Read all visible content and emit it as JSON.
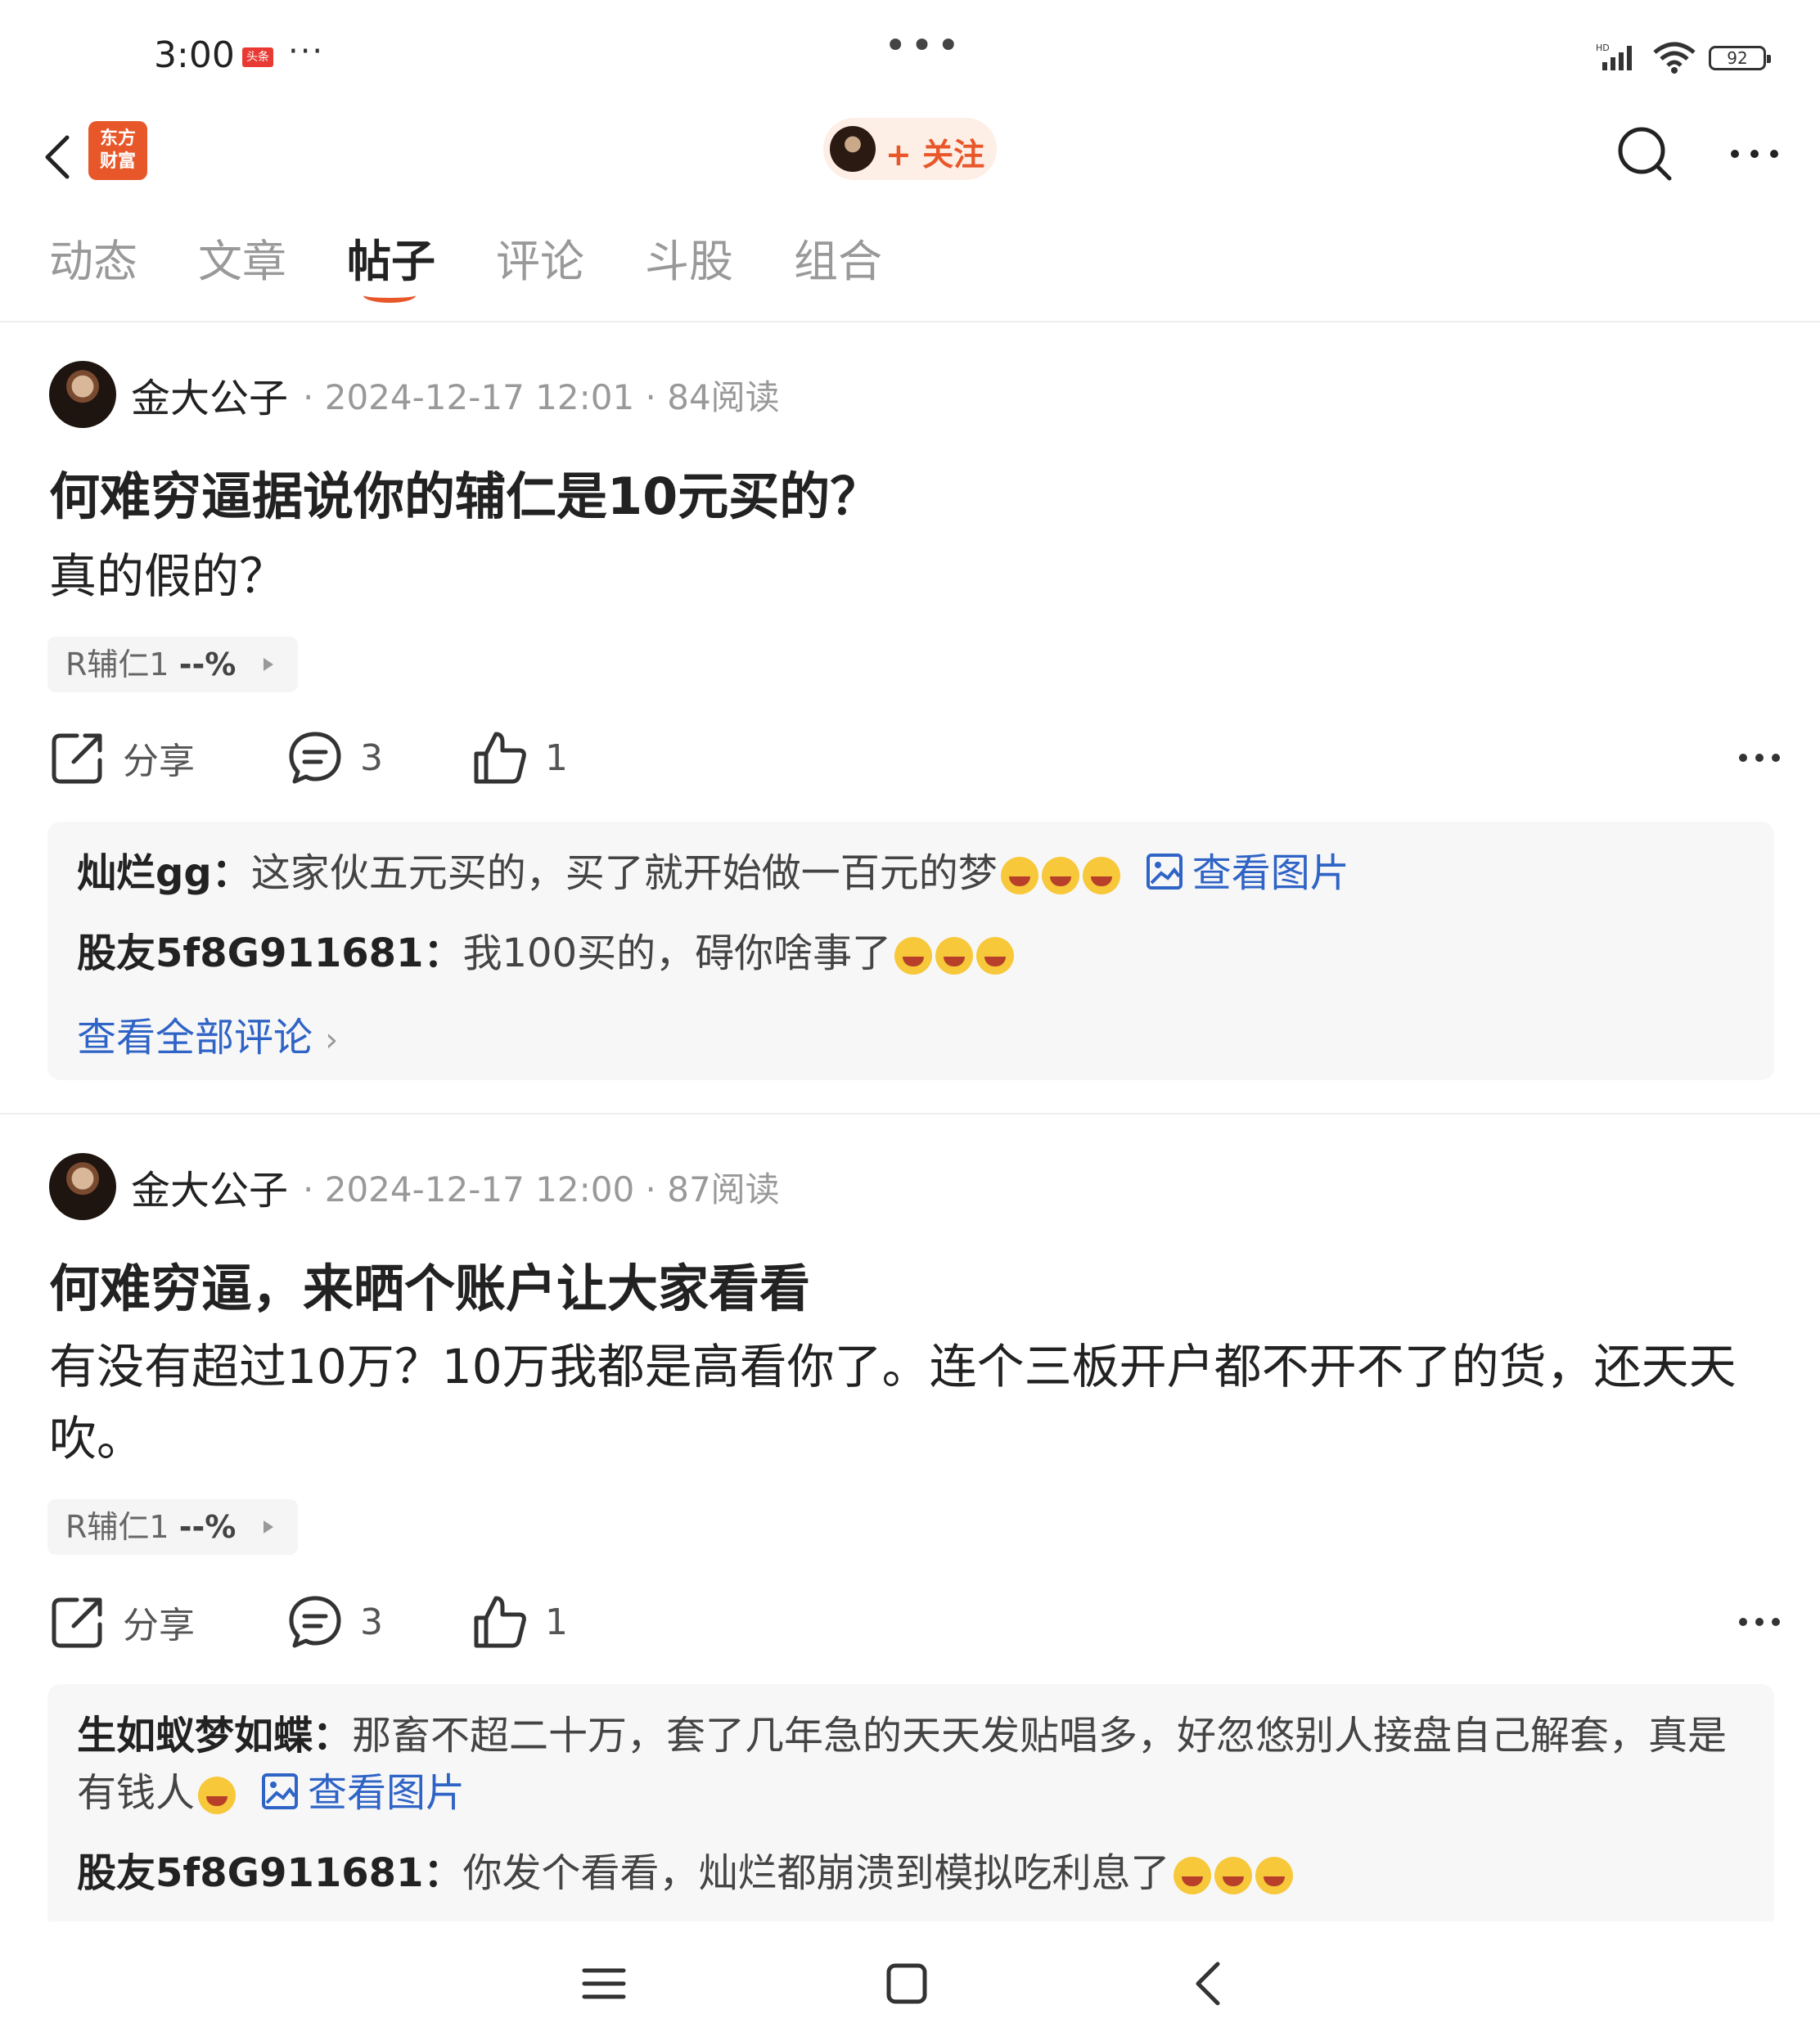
{
  "status_bar": {
    "time": "3:00",
    "badge": "头条",
    "more": "···",
    "center": "•••",
    "battery": "92"
  },
  "header": {
    "logo": "东方\n财富",
    "follow_label": "+ 关注"
  },
  "tabs": [
    "动态",
    "文章",
    "帖子",
    "评论",
    "斗股",
    "组合"
  ],
  "active_tab": "帖子",
  "posts": [
    {
      "author": "金大公子",
      "meta": "· 2024-12-17 12:01 · 84阅读",
      "title": "何难穷逼据说你的辅仁是10元买的？",
      "body": "真的假的？",
      "stock_tag": "R辅仁1",
      "stock_pct": "--%",
      "share_label": "分享",
      "comment_count": "3",
      "like_count": "1",
      "comments": [
        {
          "user": "灿烂gg：",
          "text": "这家伙五元买的，买了就开始做一百元的梦",
          "view_image": "查看图片"
        },
        {
          "user": "股友5f8G911681：",
          "text": "我100买的，碍你啥事了"
        }
      ],
      "view_all": "查看全部评论"
    },
    {
      "author": "金大公子",
      "meta": "· 2024-12-17 12:00 · 87阅读",
      "title": "何难穷逼，来晒个账户让大家看看",
      "body": "有没有超过10万？10万我都是高看你了。连个三板开户都不开不了的货，还天天吹。",
      "stock_tag": "R辅仁1",
      "stock_pct": "--%",
      "share_label": "分享",
      "comment_count": "3",
      "like_count": "1",
      "comments": [
        {
          "user": "生如蚁梦如蝶：",
          "text": "那畜不超二十万，套了几年急的天天发贴唱多，好忽悠别人接盘自己解套，真是有钱人",
          "view_image": "查看图片"
        },
        {
          "user": "股友5f8G911681：",
          "text": "你发个看看，灿烂都崩溃到模拟吃利息了"
        }
      ]
    }
  ]
}
